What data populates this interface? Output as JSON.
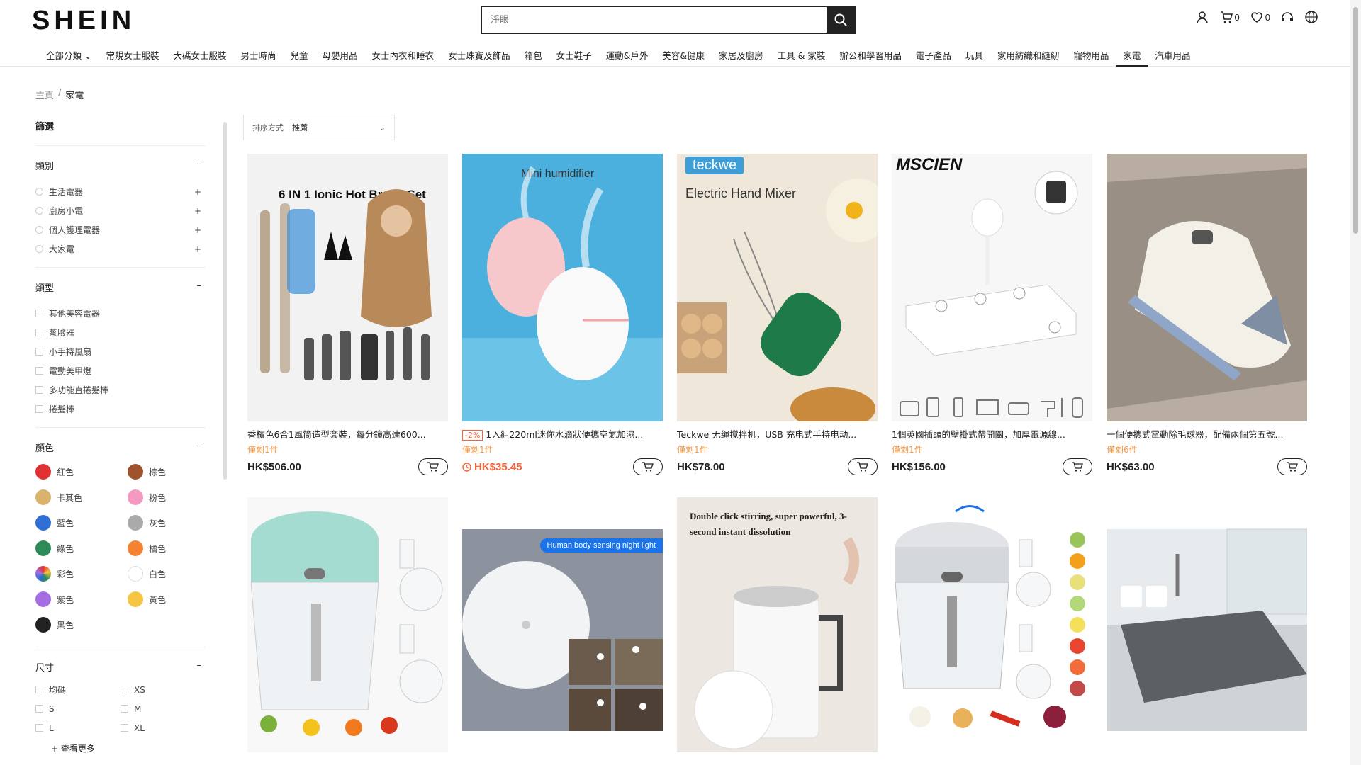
{
  "logo": "SHEIN",
  "search": {
    "placeholder": "淨眼"
  },
  "header": {
    "cart_count": "0",
    "wishlist_count": "0"
  },
  "nav": [
    "全部分類",
    "常規女士服裝",
    "大碼女士服裝",
    "男士時尚",
    "兒童",
    "母嬰用品",
    "女士內衣和睡衣",
    "女士珠寶及飾品",
    "箱包",
    "女士鞋子",
    "運動&戶外",
    "美容&健康",
    "家居及廚房",
    "工具 & 家裝",
    "辦公和學習用品",
    "電子產品",
    "玩具",
    "家用紡織和縫紉",
    "寵物用品",
    "家電",
    "汽車用品"
  ],
  "breadcrumb": {
    "home": "主頁",
    "sep": "/",
    "current": "家電"
  },
  "filter": {
    "title": "篩選",
    "category": {
      "label": "類別",
      "items": [
        "生活電器",
        "廚房小電",
        "個人護理電器",
        "大家電"
      ]
    },
    "type": {
      "label": "類型",
      "items": [
        "其他美容電器",
        "蒸臉器",
        "小手持風扇",
        "電動美甲燈",
        "多功能直捲髮棒",
        "捲髮棒"
      ]
    },
    "color": {
      "label": "顏色",
      "items": [
        {
          "name": "紅色",
          "hex": "#e03232"
        },
        {
          "name": "棕色",
          "hex": "#a0522d"
        },
        {
          "name": "卡其色",
          "hex": "#d9b36c"
        },
        {
          "name": "粉色",
          "hex": "#f49ac1"
        },
        {
          "name": "藍色",
          "hex": "#2f6fd6"
        },
        {
          "name": "灰色",
          "hex": "#aaaaaa"
        },
        {
          "name": "綠色",
          "hex": "#2e8b57"
        },
        {
          "name": "橘色",
          "hex": "#f58231"
        },
        {
          "name": "彩色",
          "hex": "multi"
        },
        {
          "name": "白色",
          "hex": "#ffffff"
        },
        {
          "name": "紫色",
          "hex": "#a56de2"
        },
        {
          "name": "黃色",
          "hex": "#f6c544"
        },
        {
          "name": "黑色",
          "hex": "#222222"
        }
      ]
    },
    "size": {
      "label": "尺寸",
      "items": [
        "均碼",
        "XS",
        "S",
        "M",
        "L",
        "XL"
      ],
      "more": "+ 查看更多"
    },
    "collapse": "–",
    "expand": "+"
  },
  "sort": {
    "label": "排序方式",
    "value": "推薦"
  },
  "products": [
    {
      "title": "香檳色6合1風筒造型套裝，每分鐘高達600...",
      "stock": "僅剩1件",
      "price": "HK$506.00",
      "img_text": "6 IN 1 Ionic Hot Brush Set"
    },
    {
      "title": "1入組220ml迷你水滴狀便攜空氣加濕...",
      "discount": "-2%",
      "stock": "僅剩1件",
      "price": "HK$35.45",
      "img_text": "Mini humidifier"
    },
    {
      "title": "Teckwe 无绳搅拌机，USB 充电式手持电动...",
      "stock": "僅剩1件",
      "price": "HK$78.00",
      "img_brand": "teckwe",
      "img_text": "Electric Hand Mixer"
    },
    {
      "title": "1個英國插頭的壁掛式帶開關，加厚電源線...",
      "stock": "僅剩1件",
      "price": "HK$156.00",
      "img_brand": "MSCIEN"
    },
    {
      "title": "一個便攜式電動除毛球器，配備兩個第五號...",
      "stock": "僅剩6件",
      "price": "HK$63.00"
    },
    {
      "img_text": ""
    },
    {
      "img_text": "Human body sensing night light"
    },
    {
      "img_text": "Double click stirring, super powerful, 3-second instant dissolution"
    },
    {
      "img_text": ""
    },
    {
      "img_text": ""
    }
  ]
}
